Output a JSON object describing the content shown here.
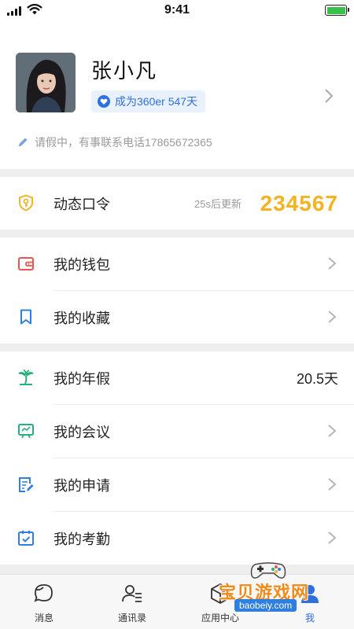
{
  "status_bar": {
    "time": "9:41"
  },
  "profile": {
    "name": "张小凡",
    "badge_text": "成为360er 547天",
    "status_text": "请假中，有事联系电话17865672365"
  },
  "otp": {
    "label": "动态口令",
    "update_text": "25s后更新",
    "code": "234567"
  },
  "menu_group_1": [
    {
      "label": "我的钱包"
    },
    {
      "label": "我的收藏"
    }
  ],
  "menu_group_2": [
    {
      "label": "我的年假",
      "value": "20.5天"
    },
    {
      "label": "我的会议"
    },
    {
      "label": "我的申请"
    },
    {
      "label": "我的考勤"
    }
  ],
  "tabbar": [
    {
      "label": "消息"
    },
    {
      "label": "通讯录"
    },
    {
      "label": "应用中心"
    },
    {
      "label": "我",
      "active": true
    }
  ],
  "watermark": {
    "text": "宝贝游戏网",
    "url": "baobeiy.com"
  },
  "colors": {
    "accent": "#2f6fde",
    "otp_code": "#f5b322",
    "icon_yellow": "#f0b429",
    "icon_red": "#e8574d",
    "icon_blue": "#2f7fe0",
    "icon_green": "#27b07a"
  }
}
